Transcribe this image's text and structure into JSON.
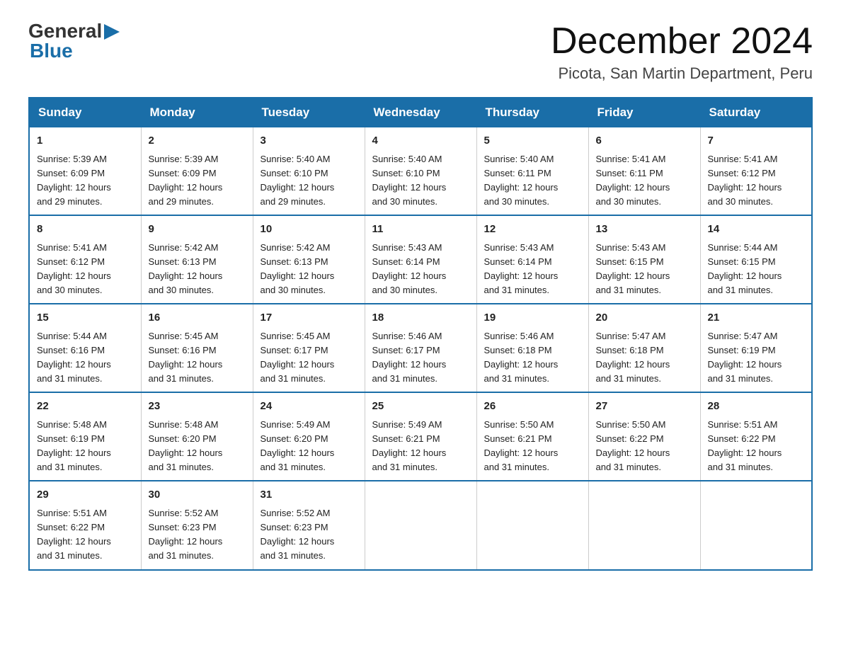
{
  "header": {
    "logo_general": "General",
    "logo_blue": "Blue",
    "title": "December 2024",
    "subtitle": "Picota, San Martin Department, Peru"
  },
  "days_of_week": [
    "Sunday",
    "Monday",
    "Tuesday",
    "Wednesday",
    "Thursday",
    "Friday",
    "Saturday"
  ],
  "weeks": [
    [
      {
        "day": "1",
        "sunrise": "5:39 AM",
        "sunset": "6:09 PM",
        "daylight": "12 hours and 29 minutes."
      },
      {
        "day": "2",
        "sunrise": "5:39 AM",
        "sunset": "6:09 PM",
        "daylight": "12 hours and 29 minutes."
      },
      {
        "day": "3",
        "sunrise": "5:40 AM",
        "sunset": "6:10 PM",
        "daylight": "12 hours and 29 minutes."
      },
      {
        "day": "4",
        "sunrise": "5:40 AM",
        "sunset": "6:10 PM",
        "daylight": "12 hours and 30 minutes."
      },
      {
        "day": "5",
        "sunrise": "5:40 AM",
        "sunset": "6:11 PM",
        "daylight": "12 hours and 30 minutes."
      },
      {
        "day": "6",
        "sunrise": "5:41 AM",
        "sunset": "6:11 PM",
        "daylight": "12 hours and 30 minutes."
      },
      {
        "day": "7",
        "sunrise": "5:41 AM",
        "sunset": "6:12 PM",
        "daylight": "12 hours and 30 minutes."
      }
    ],
    [
      {
        "day": "8",
        "sunrise": "5:41 AM",
        "sunset": "6:12 PM",
        "daylight": "12 hours and 30 minutes."
      },
      {
        "day": "9",
        "sunrise": "5:42 AM",
        "sunset": "6:13 PM",
        "daylight": "12 hours and 30 minutes."
      },
      {
        "day": "10",
        "sunrise": "5:42 AM",
        "sunset": "6:13 PM",
        "daylight": "12 hours and 30 minutes."
      },
      {
        "day": "11",
        "sunrise": "5:43 AM",
        "sunset": "6:14 PM",
        "daylight": "12 hours and 30 minutes."
      },
      {
        "day": "12",
        "sunrise": "5:43 AM",
        "sunset": "6:14 PM",
        "daylight": "12 hours and 31 minutes."
      },
      {
        "day": "13",
        "sunrise": "5:43 AM",
        "sunset": "6:15 PM",
        "daylight": "12 hours and 31 minutes."
      },
      {
        "day": "14",
        "sunrise": "5:44 AM",
        "sunset": "6:15 PM",
        "daylight": "12 hours and 31 minutes."
      }
    ],
    [
      {
        "day": "15",
        "sunrise": "5:44 AM",
        "sunset": "6:16 PM",
        "daylight": "12 hours and 31 minutes."
      },
      {
        "day": "16",
        "sunrise": "5:45 AM",
        "sunset": "6:16 PM",
        "daylight": "12 hours and 31 minutes."
      },
      {
        "day": "17",
        "sunrise": "5:45 AM",
        "sunset": "6:17 PM",
        "daylight": "12 hours and 31 minutes."
      },
      {
        "day": "18",
        "sunrise": "5:46 AM",
        "sunset": "6:17 PM",
        "daylight": "12 hours and 31 minutes."
      },
      {
        "day": "19",
        "sunrise": "5:46 AM",
        "sunset": "6:18 PM",
        "daylight": "12 hours and 31 minutes."
      },
      {
        "day": "20",
        "sunrise": "5:47 AM",
        "sunset": "6:18 PM",
        "daylight": "12 hours and 31 minutes."
      },
      {
        "day": "21",
        "sunrise": "5:47 AM",
        "sunset": "6:19 PM",
        "daylight": "12 hours and 31 minutes."
      }
    ],
    [
      {
        "day": "22",
        "sunrise": "5:48 AM",
        "sunset": "6:19 PM",
        "daylight": "12 hours and 31 minutes."
      },
      {
        "day": "23",
        "sunrise": "5:48 AM",
        "sunset": "6:20 PM",
        "daylight": "12 hours and 31 minutes."
      },
      {
        "day": "24",
        "sunrise": "5:49 AM",
        "sunset": "6:20 PM",
        "daylight": "12 hours and 31 minutes."
      },
      {
        "day": "25",
        "sunrise": "5:49 AM",
        "sunset": "6:21 PM",
        "daylight": "12 hours and 31 minutes."
      },
      {
        "day": "26",
        "sunrise": "5:50 AM",
        "sunset": "6:21 PM",
        "daylight": "12 hours and 31 minutes."
      },
      {
        "day": "27",
        "sunrise": "5:50 AM",
        "sunset": "6:22 PM",
        "daylight": "12 hours and 31 minutes."
      },
      {
        "day": "28",
        "sunrise": "5:51 AM",
        "sunset": "6:22 PM",
        "daylight": "12 hours and 31 minutes."
      }
    ],
    [
      {
        "day": "29",
        "sunrise": "5:51 AM",
        "sunset": "6:22 PM",
        "daylight": "12 hours and 31 minutes."
      },
      {
        "day": "30",
        "sunrise": "5:52 AM",
        "sunset": "6:23 PM",
        "daylight": "12 hours and 31 minutes."
      },
      {
        "day": "31",
        "sunrise": "5:52 AM",
        "sunset": "6:23 PM",
        "daylight": "12 hours and 31 minutes."
      },
      null,
      null,
      null,
      null
    ]
  ],
  "labels": {
    "sunrise": "Sunrise:",
    "sunset": "Sunset:",
    "daylight": "Daylight:"
  }
}
